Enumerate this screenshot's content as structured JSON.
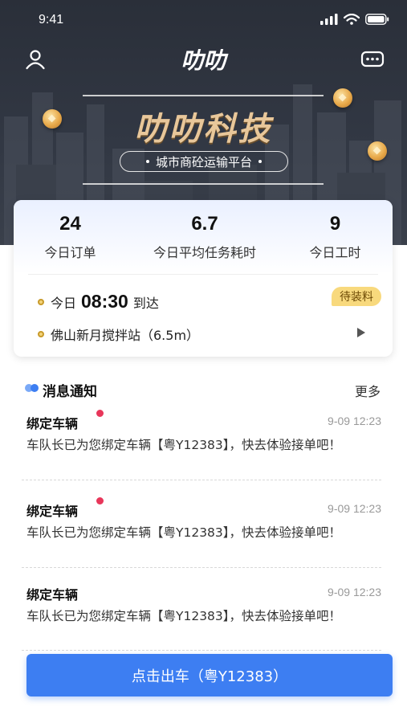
{
  "status_bar": {
    "time": "9:41"
  },
  "nav": {
    "logo": "叻叻"
  },
  "hero": {
    "title": "叻叻科技",
    "subtitle": "城市商砼运输平台"
  },
  "stats": [
    {
      "value": "24",
      "label": "今日订单"
    },
    {
      "value": "6.7",
      "label": "今日平均任务耗时"
    },
    {
      "value": "9",
      "label": "今日工时"
    }
  ],
  "arrival": {
    "prefix": "今日",
    "time": "08:30",
    "suffix": "到达",
    "status": "待装料"
  },
  "location": {
    "text": "佛山新月搅拌站（6.5m）"
  },
  "messages": {
    "title": "消息通知",
    "more": "更多",
    "items": [
      {
        "title": "绑定车辆",
        "time": "9-09 12:23",
        "unread": true,
        "body": "车队长已为您绑定车辆【粤Y12383】，快去体验接单吧！"
      },
      {
        "title": "绑定车辆",
        "time": "9-09 12:23",
        "unread": true,
        "body": "车队长已为您绑定车辆【粤Y12383】，快去体验接单吧！"
      },
      {
        "title": "绑定车辆",
        "time": "9-09 12:23",
        "unread": false,
        "body": "车队长已为您绑定车辆【粤Y12383】，快去体验接单吧！"
      }
    ]
  },
  "cta": {
    "label": "点击出车（粤Y12383）"
  },
  "colors": {
    "accent": "#3d7ef2",
    "unread_dot": "#e8365a",
    "badge": "#f8d97d",
    "hero_bg": "#2f3440",
    "title_gold": "#e8c79a"
  }
}
